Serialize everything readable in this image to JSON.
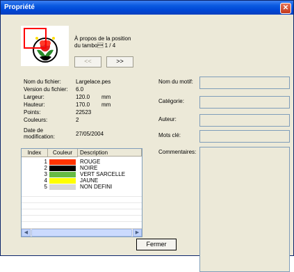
{
  "window": {
    "title": "Propriété",
    "close_glyph": "✕"
  },
  "preview": {
    "caption_line1": "À propos de la position",
    "caption_line2": "du tambo\u0001 1 / 4",
    "prev_label": "<<",
    "next_label": ">>"
  },
  "info": {
    "file_name_label": "Nom du fichier:",
    "file_name": "Largelace.pes",
    "version_label": "Version du fichier:",
    "version": "6.0",
    "width_label": "Largeur:",
    "width": "120.0",
    "width_unit": "mm",
    "height_label": "Hauteur:",
    "height": "170.0",
    "height_unit": "mm",
    "points_label": "Points:",
    "points": "22523",
    "colors_label": "Couleurs:",
    "colors": "2",
    "date_label_line1": "Date de",
    "date_label_line2": "modification:",
    "date": "27/05/2004"
  },
  "table": {
    "headers": [
      "Index",
      "Couleur",
      "Description"
    ],
    "rows": [
      {
        "index": "1",
        "color": "#ff3300",
        "description": "ROUGE"
      },
      {
        "index": "2",
        "color": "#000000",
        "description": "NOIRE"
      },
      {
        "index": "3",
        "color": "#66bb44",
        "description": "VERT SARCELLE"
      },
      {
        "index": "4",
        "color": "#ffff00",
        "description": "JAUNE"
      },
      {
        "index": "5",
        "color": "#d8d8d8",
        "description": "NON DEFINI"
      }
    ]
  },
  "meta": {
    "motif_label": "Nom du motif:",
    "category_label": "Catégorie:",
    "author_label": "Auteur:",
    "keywords_label": "Mots clé:",
    "comments_label": "Commentaires:"
  },
  "footer": {
    "close_label": "Fermer"
  }
}
